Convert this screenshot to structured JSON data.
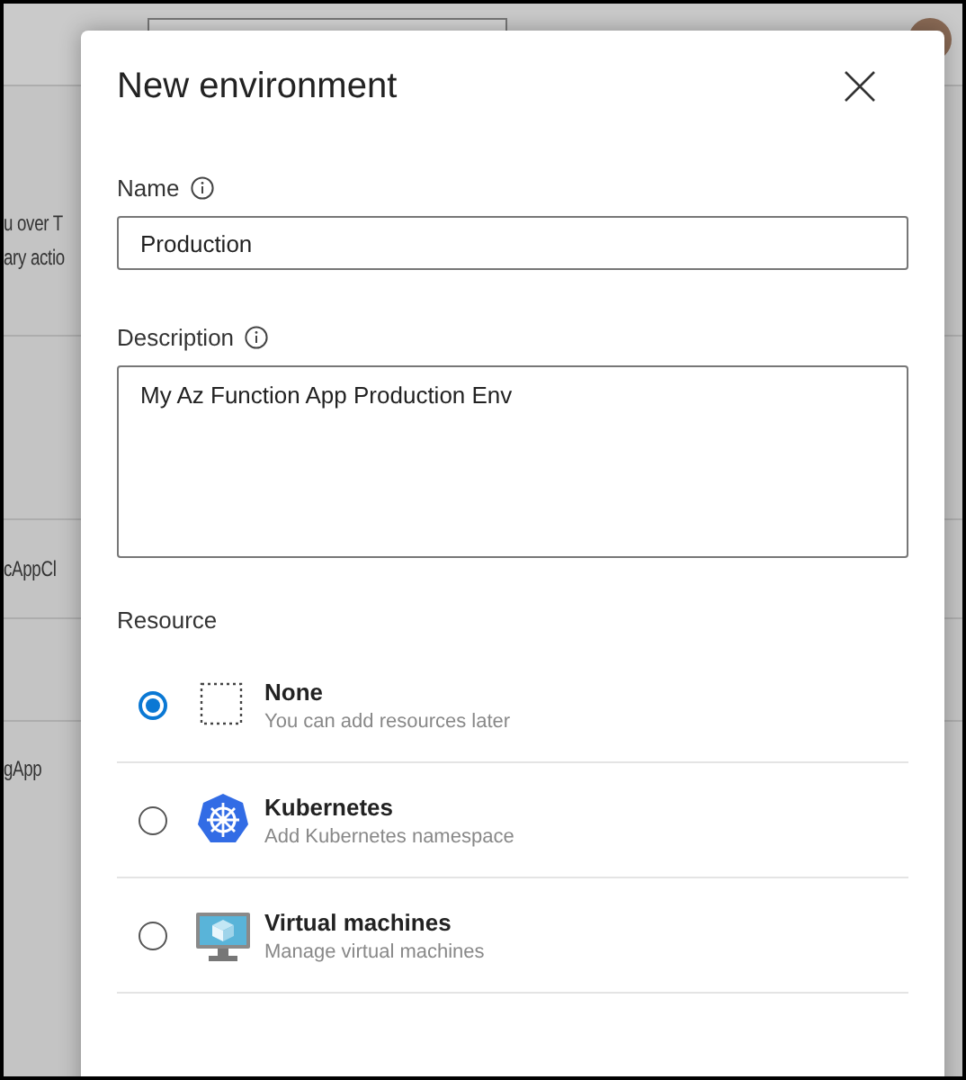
{
  "background": {
    "texts": [
      "u over T",
      "ary actio"
    ],
    "rows": [
      "",
      "cAppCl",
      "",
      "gApp"
    ]
  },
  "dialog": {
    "title": "New environment",
    "fields": [
      {
        "label": "Name",
        "kind": "input",
        "value": "Production"
      },
      {
        "label": "Description",
        "kind": "textarea",
        "value": "My Az Function App Production Env"
      }
    ],
    "resource_label": "Resource",
    "resources": [
      {
        "kind": "none",
        "title": "None",
        "subtitle": "You can add resources later",
        "selected": true
      },
      {
        "kind": "kubernetes",
        "title": "Kubernetes",
        "subtitle": "Add Kubernetes namespace",
        "selected": false
      },
      {
        "kind": "vm",
        "title": "Virtual machines",
        "subtitle": "Manage virtual machines",
        "selected": false
      }
    ]
  }
}
